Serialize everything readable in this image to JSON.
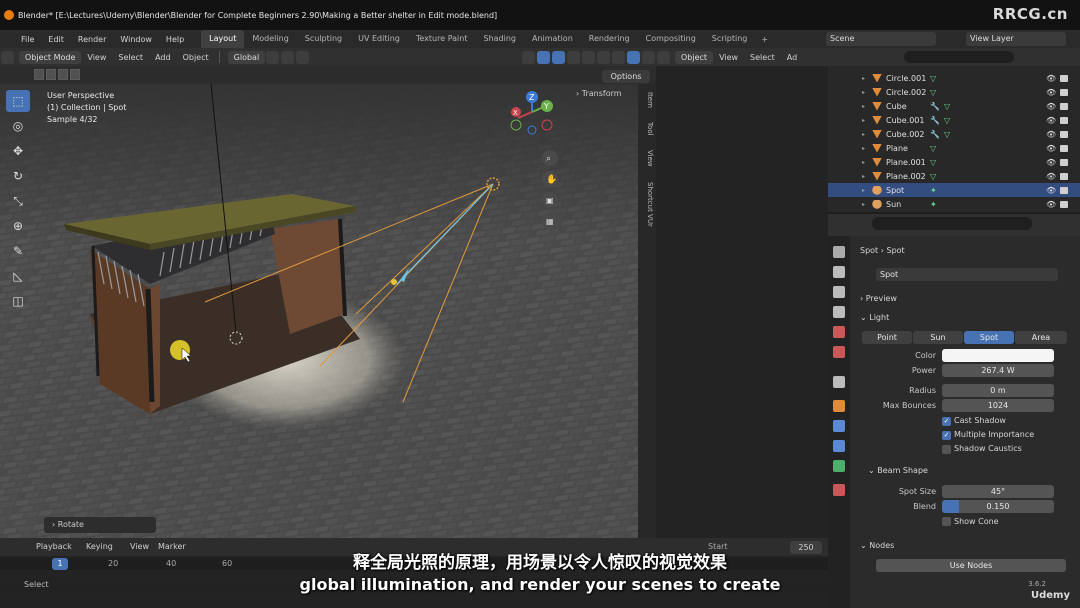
{
  "window": {
    "title": "Blender* [E:\\Lectures\\Udemy\\Blender\\Blender for Complete Beginners 2.90\\Making a Better shelter in Edit mode.blend]",
    "watermark": "RRCG.cn"
  },
  "menubar": {
    "menus": [
      "File",
      "Edit",
      "Render",
      "Window",
      "Help"
    ],
    "workspaces": [
      "Layout",
      "Modeling",
      "Sculpting",
      "UV Editing",
      "Texture Paint",
      "Shading",
      "Animation",
      "Rendering",
      "Compositing",
      "Scripting"
    ],
    "active_workspace": "Layout",
    "add_workspace": "+",
    "scene": "Scene",
    "view_layer": "View Layer"
  },
  "viewport_header": {
    "mode": "Object Mode",
    "menus": [
      "View",
      "Select",
      "Add",
      "Object"
    ],
    "orientation": "Global",
    "options": "Options"
  },
  "viewport": {
    "perspective": "User Perspective",
    "collection": "(1) Collection | Spot",
    "sample": "Sample 4/32",
    "transform_tab": "Transform",
    "side_tabs": [
      "Item",
      "Tool",
      "View",
      "Shortcut VUr"
    ],
    "last_operator": "Rotate",
    "gizmo_axes": [
      "Z",
      "Y",
      "X"
    ]
  },
  "toolbar": {
    "tools": [
      "select-box",
      "cursor",
      "move",
      "rotate",
      "scale",
      "transform",
      "annotate",
      "measure",
      "add-cube"
    ]
  },
  "viewport2_header": {
    "mode": "Object",
    "menus": [
      "View",
      "Select",
      "Ad"
    ]
  },
  "outliner": {
    "rows": [
      {
        "name": "Circle.001",
        "mod": false,
        "data": "mesh",
        "selected": false
      },
      {
        "name": "Circle.002",
        "mod": false,
        "data": "mesh",
        "selected": false
      },
      {
        "name": "Cube",
        "mod": true,
        "data": "mesh",
        "selected": false
      },
      {
        "name": "Cube.001",
        "mod": true,
        "data": "mesh",
        "selected": false
      },
      {
        "name": "Cube.002",
        "mod": true,
        "data": "mesh",
        "selected": false
      },
      {
        "name": "Plane",
        "mod": false,
        "data": "mesh",
        "selected": false
      },
      {
        "name": "Plane.001",
        "mod": false,
        "data": "mesh",
        "selected": false
      },
      {
        "name": "Plane.002",
        "mod": false,
        "data": "mesh",
        "selected": false
      },
      {
        "name": "Spot",
        "mod": false,
        "data": "light",
        "selected": true
      },
      {
        "name": "Sun",
        "mod": false,
        "data": "light",
        "selected": false
      }
    ]
  },
  "properties": {
    "breadcrumb": [
      "Spot",
      "Spot"
    ],
    "datablock": "Spot",
    "preview_panel": "Preview",
    "light_panel": "Light",
    "light_types": [
      "Point",
      "Sun",
      "Spot",
      "Area"
    ],
    "active_light_type": "Spot",
    "fields": {
      "color_label": "Color",
      "power_label": "Power",
      "power_value": "267.4 W",
      "radius_label": "Radius",
      "radius_value": "0 m",
      "bounces_label": "Max Bounces",
      "bounces_value": "1024"
    },
    "checkboxes": [
      {
        "label": "Cast Shadow",
        "checked": true
      },
      {
        "label": "Multiple Importance",
        "checked": true
      },
      {
        "label": "Shadow Caustics",
        "checked": false
      }
    ],
    "beam_shape": {
      "panel": "Beam Shape",
      "spot_size_label": "Spot Size",
      "spot_size_value": "45°",
      "blend_label": "Blend",
      "blend_value": "0.150",
      "blend_fraction": 0.15,
      "show_cone": "Show Cone"
    },
    "nodes_panel": "Nodes",
    "use_nodes": "Use Nodes"
  },
  "timeline": {
    "menus": [
      "Playback",
      "Keying",
      "View",
      "Marker"
    ],
    "current_frame": "1",
    "ticks": [
      "20",
      "40",
      "60"
    ],
    "start_label": "Start",
    "end_value": "250"
  },
  "statusbar": {
    "left": "Select",
    "version": "3.6.2"
  },
  "subtitles": {
    "cn": "释全局光照的原理，用场景以令人惊叹的视觉效果",
    "en": "global illumination, and render your scenes to create"
  },
  "brand": "Udemy",
  "colors": {
    "accent": "#4772b3",
    "light_line": "#e09a3c",
    "selected_row": "#334d80"
  }
}
